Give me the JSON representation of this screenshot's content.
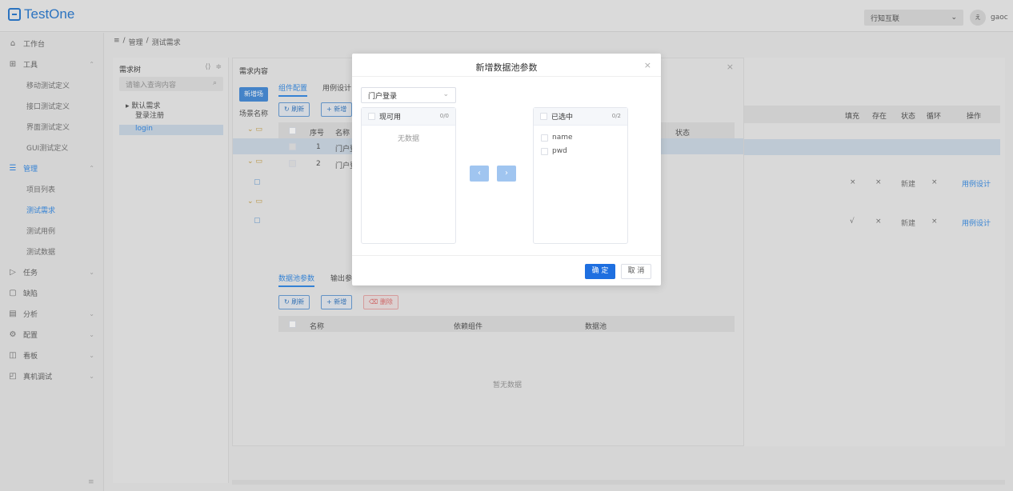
{
  "app": {
    "logo_text": "TestOne"
  },
  "header": {
    "org_select": "行知互联",
    "user_initial": "ぇ",
    "user_name": "gaoc"
  },
  "sidebar": {
    "items": [
      {
        "icon": "home-icon",
        "label": "工作台"
      },
      {
        "icon": "grid-icon",
        "label": "工具"
      },
      {
        "sub": "移动测试定义"
      },
      {
        "sub": "接口测试定义"
      },
      {
        "sub": "界面测试定义"
      },
      {
        "sub": "GUI测试定义"
      },
      {
        "icon": "list-icon",
        "label": "管理"
      },
      {
        "sub": "项目列表"
      },
      {
        "sub": "测试需求"
      },
      {
        "sub": "测试用例"
      },
      {
        "sub": "测试数据"
      },
      {
        "icon": "play-icon",
        "label": "任务"
      },
      {
        "icon": "doc-icon",
        "label": "缺陷"
      },
      {
        "icon": "calendar-icon",
        "label": "分析"
      },
      {
        "icon": "gear-icon",
        "label": "配置"
      },
      {
        "icon": "board-icon",
        "label": "看板"
      },
      {
        "icon": "device-icon",
        "label": "真机调试"
      }
    ],
    "collapse_icon": "≡"
  },
  "breadcrumb": {
    "menu_icon": "≡",
    "sep": "/",
    "p1": "管理",
    "p2": "测试需求"
  },
  "tree": {
    "title": "需求树",
    "search_placeholder": "请输入查询内容",
    "root": "默认需求",
    "child1": "登录注册",
    "child2": "login"
  },
  "main": {
    "title": "需求内容",
    "new_btn": "新增场",
    "scene_col": "场景名称",
    "tab1": "组件配置",
    "tab2": "用例设计",
    "refresh": "刷新",
    "add": "新增",
    "col_index": "序号",
    "col_name": "名称",
    "col_status": "状态",
    "row1_index": "1",
    "row1_name": "门户登",
    "row2_index": "2",
    "row2_name": "门户登",
    "tab3": "数据池参数",
    "tab4": "输出参",
    "refresh2": "刷新",
    "add2": "新增",
    "delete2": "删除",
    "col2_name": "名称",
    "col2_dep": "依赖组件",
    "col2_pool": "数据池",
    "empty": "暂无数据"
  },
  "right_table": {
    "headers": [
      "填充",
      "存在",
      "状态",
      "循环",
      "操作"
    ],
    "rows": [
      [
        "×",
        "×",
        "新建",
        "×",
        "用例设计"
      ],
      [
        "√",
        "×",
        "新建",
        "×",
        "用例设计"
      ]
    ]
  },
  "modal": {
    "title": "新增数据池参数",
    "select_value": "门户登录",
    "left_title": "现可用",
    "left_count": "0/0",
    "left_empty": "无数据",
    "right_title": "已选中",
    "right_count": "0/2",
    "right_items": [
      "name",
      "pwd"
    ],
    "ok": "确 定",
    "cancel": "取 消"
  }
}
